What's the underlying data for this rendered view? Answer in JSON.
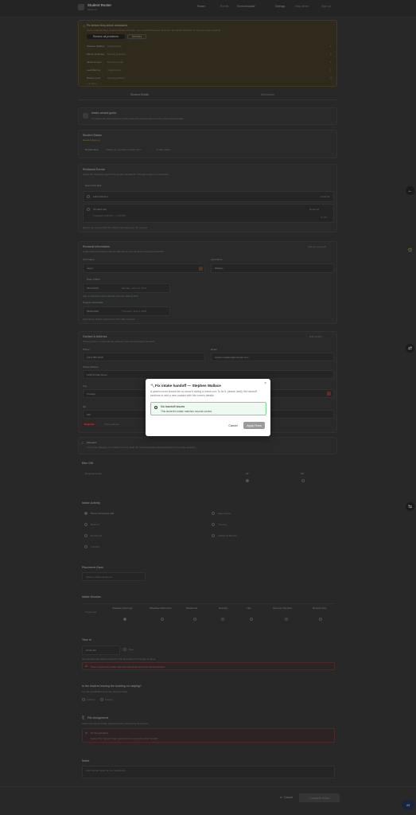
{
  "header": {
    "title": "Student Roster",
    "subtitle": "Week 12",
    "nav": [
      "Roster",
      "Events",
      "Event template"
    ],
    "right_links": [
      "Settings",
      "Help center",
      "Sign out"
    ]
  },
  "warning_banner": {
    "title": "Fix before they block reminders",
    "text": "Some students have invalid contacts. Fix them now to avoid bounced reminders and failed handoffs for the upcoming schedule.",
    "primary_button": "Review all problems",
    "secondary_button": "Dismiss",
    "rows": [
      {
        "name": "Stephen Wallace",
        "detail": "Invalid phone",
        "count": "1"
      },
      {
        "name": "Marion Holloway",
        "detail": "Missing guardian",
        "count": "2"
      },
      {
        "name": "Janet Kemper",
        "detail": "Bounced email",
        "count": "1"
      },
      {
        "name": "Leah Barrow",
        "detail": "Invalid phone",
        "count": "1"
      },
      {
        "name": "Danny Lyons",
        "detail": "Missing address",
        "count": "3"
      }
    ],
    "more": "+ 2 more"
  },
  "tabs": {
    "left": "Student Details",
    "right": "Attendance"
  },
  "intake_guide": {
    "title": "Intake wizard guide",
    "text": "Complete the steps below to finish onboarding this student into the roster and schedule."
  },
  "student_status": {
    "title": "Student Status",
    "status": "Needs follow-up",
    "row_label": "Not Enrolled",
    "row_text": "Waiting on guardian consent form",
    "row_link": "Update status"
  },
  "fieldwork": {
    "title": "Fieldwork Events",
    "text": "Select the fieldwork events this student will attend. Changes notify the coordinator.",
    "label": "Event schedule",
    "items": [
      {
        "name": "Lake Monitors",
        "tag": "Optional"
      },
      {
        "name": "Orchard Lab",
        "tag": "Required",
        "sub": "Tuesdays 3:30 PM — 5:00 PM",
        "count": "4 / 20"
      }
    ],
    "footnote": "Events are synced with the district calendar every 15 minutes."
  },
  "personal": {
    "title": "Personal Information",
    "text": "Legal name and dates used for attendance records and emergency handoffs.",
    "edit": "Edit personal info",
    "first_name_label": "First Name",
    "first_name": "Jason",
    "last_name_label": "Last Name",
    "last_name": "Wallace",
    "dob_label": "Date of Birth",
    "dob": "06/14/2012",
    "dob_human": "Monday, June 14, 2012",
    "dob_note": "Age is calculated automatically from the date of birth",
    "start_label": "Program Start Date",
    "start": "06/01/2026",
    "start_human": "Thursday, June 1, 2026",
    "start_note": "Attendance will be tracked from this date forward."
  },
  "contact": {
    "title": "Contact & Address",
    "text": "Primary phone, email and the address used for emergency handoffs.",
    "edit": "Edit contact",
    "phone_label": "Phone",
    "phone": "(312) 555-0148",
    "email_label": "Email",
    "email": "stephen.wallace@example.com",
    "street_label": "Street Address",
    "street": "1458 W Oak Street",
    "city_label": "City",
    "city": "Chicago",
    "zip_label": "Zip",
    "zip": "606",
    "error_badge": "Required",
    "error_link": "Verify address"
  },
  "allergies": {
    "title": "Allergies",
    "text": "List known allergies or medical notes so staff can respond quickly during fieldwork and on-site sessions."
  },
  "bike_gift": {
    "title": "Bike Gift",
    "row_label": "Requested size",
    "col1": "24\"",
    "col2": "26\""
  },
  "intake_activity": {
    "title": "Intake Activity",
    "options": [
      "Phone Screening Call",
      "Open House",
      "Referral",
      "Tutoring",
      "Enrollment",
      "Additional Review",
      "Transfer"
    ]
  },
  "placement": {
    "title": "Placement Class",
    "placeholder": "Select a class placement"
  },
  "intake_session": {
    "title": "Intake Session",
    "row_label": "Preference",
    "cols": [
      "Weekday Mornings",
      "Weekday Afternoons",
      "Weekends",
      "Evening",
      "Flex",
      "Summer Intensive",
      "Remote Only"
    ]
  },
  "time_in": {
    "title": "Time In",
    "value": "10:01 AM",
    "extra": "Now",
    "help": "Use the time the student arrived or the time listed on the sign-in sheet.",
    "error": "Time in cannot be earlier than the scheduled start time for this session."
  },
  "leaving": {
    "title": "Is the student leaving the building on staying?",
    "text": "Let the coordinator know the plan for today.",
    "opt1": "Leaving",
    "opt2": "Staying"
  },
  "file_assignment": {
    "title": "File Assignment",
    "text": "Attach the signed intake packet and any supporting documents.",
    "error_title": "No file uploaded",
    "error_text": "Upload the signed intake packet before completing this handoff."
  },
  "notes": {
    "title": "Notes",
    "placeholder": "Add internal notes for the coordinator..."
  },
  "footer": {
    "cancel": "Cancel",
    "submit": "Complete Intake"
  },
  "modal": {
    "title": "Fix intake handoff — Stephen Wallace",
    "close": "×",
    "description": "A parent cover should be no-show'd during a check-out. To fix it, please verify the handoff sections or add a new contact with the correct details.",
    "option_title": "No handoff issues",
    "option_sub": "This student's intake matches records correct.",
    "cancel": "Cancel",
    "apply": "Apply Fixes"
  },
  "side_buttons": [
    "←",
    "☼",
    "⇄",
    "⇆"
  ],
  "corner_badge": "43"
}
